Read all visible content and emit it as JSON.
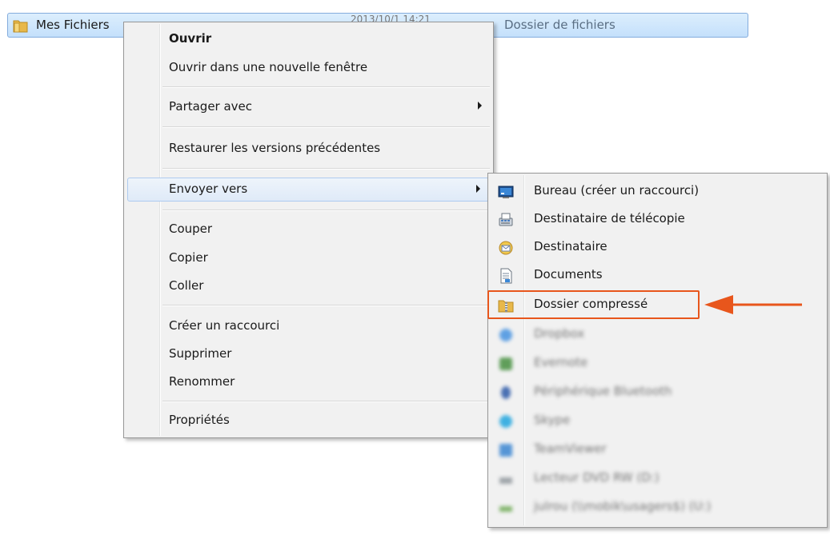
{
  "explorer_row": {
    "name": "Mes Fichiers",
    "date": "2013/10/1 14:21",
    "type": "Dossier de fichiers"
  },
  "context_menu": {
    "items": [
      {
        "label": "Ouvrir",
        "bold": true
      },
      {
        "label": "Ouvrir dans une nouvelle fenêtre"
      },
      {
        "label": "Partager avec",
        "submenu": true
      },
      {
        "label": "Restaurer les versions précédentes"
      },
      {
        "label": "Envoyer vers",
        "submenu": true,
        "highlighted": true
      },
      {
        "label": "Couper"
      },
      {
        "label": "Copier"
      },
      {
        "label": "Coller"
      },
      {
        "label": "Créer un raccourci"
      },
      {
        "label": "Supprimer"
      },
      {
        "label": "Renommer"
      },
      {
        "label": "Propriétés"
      }
    ]
  },
  "send_to_submenu": {
    "items": [
      {
        "label": "Bureau (créer un raccourci)",
        "icon": "desktop-icon"
      },
      {
        "label": "Destinataire de télécopie",
        "icon": "fax-icon"
      },
      {
        "label": "Destinataire",
        "icon": "mail-recipient-icon"
      },
      {
        "label": "Documents",
        "icon": "documents-icon"
      },
      {
        "label": "Dossier compressé",
        "icon": "zip-folder-icon",
        "annotated": true
      },
      {
        "label": "Dropbox",
        "icon": "dropbox-icon",
        "blurred": true
      },
      {
        "label": "Evernote",
        "icon": "evernote-icon",
        "blurred": true
      },
      {
        "label": "Périphérique Bluetooth",
        "icon": "bluetooth-icon",
        "blurred": true
      },
      {
        "label": "Skype",
        "icon": "skype-icon",
        "blurred": true
      },
      {
        "label": "TeamViewer",
        "icon": "teamviewer-icon",
        "blurred": true
      },
      {
        "label": "Lecteur DVD RW (D:)",
        "icon": "dvd-drive-icon",
        "blurred": true
      },
      {
        "label": "julrou (\\\\mobik\\usagers$) (U:)",
        "icon": "network-drive-icon",
        "blurred": true
      }
    ]
  },
  "colors": {
    "annotation": "#e8561c",
    "selection_border": "#84acdd",
    "menu_background": "#f1f1f1"
  }
}
